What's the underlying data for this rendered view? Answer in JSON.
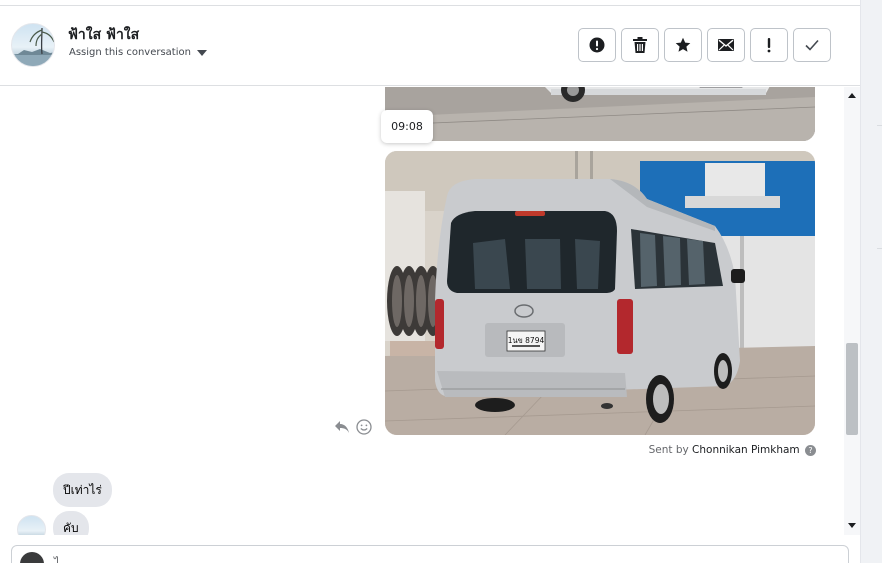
{
  "header": {
    "contact_name": "ฟ้าใส ฟ้าใส",
    "assign_label": "Assign this conversation",
    "actions": [
      {
        "icon": "alert-circle-icon",
        "name": "mark-spam-button"
      },
      {
        "icon": "trash-icon",
        "name": "delete-button"
      },
      {
        "icon": "star-icon",
        "name": "star-button"
      },
      {
        "icon": "envelope-icon",
        "name": "mark-unread-button"
      },
      {
        "icon": "exclamation-icon",
        "name": "follow-up-button"
      },
      {
        "icon": "checkmark-icon",
        "name": "mark-done-button"
      }
    ]
  },
  "conversation": {
    "timestamp_tooltip": "09:08",
    "image_plate": "1นข 8794",
    "sent_by_prefix": "Sent by",
    "sent_by_name": "Chonnikan Pimkham",
    "incoming_messages": [
      "ปีเท่าไร่",
      "คับ"
    ]
  },
  "composer": {
    "placeholder": "ไ..."
  },
  "colors": {
    "accent": "#1877f2",
    "bubble": "#e4e6eb",
    "border": "#dddfe2",
    "van": "#d4d6d8"
  }
}
